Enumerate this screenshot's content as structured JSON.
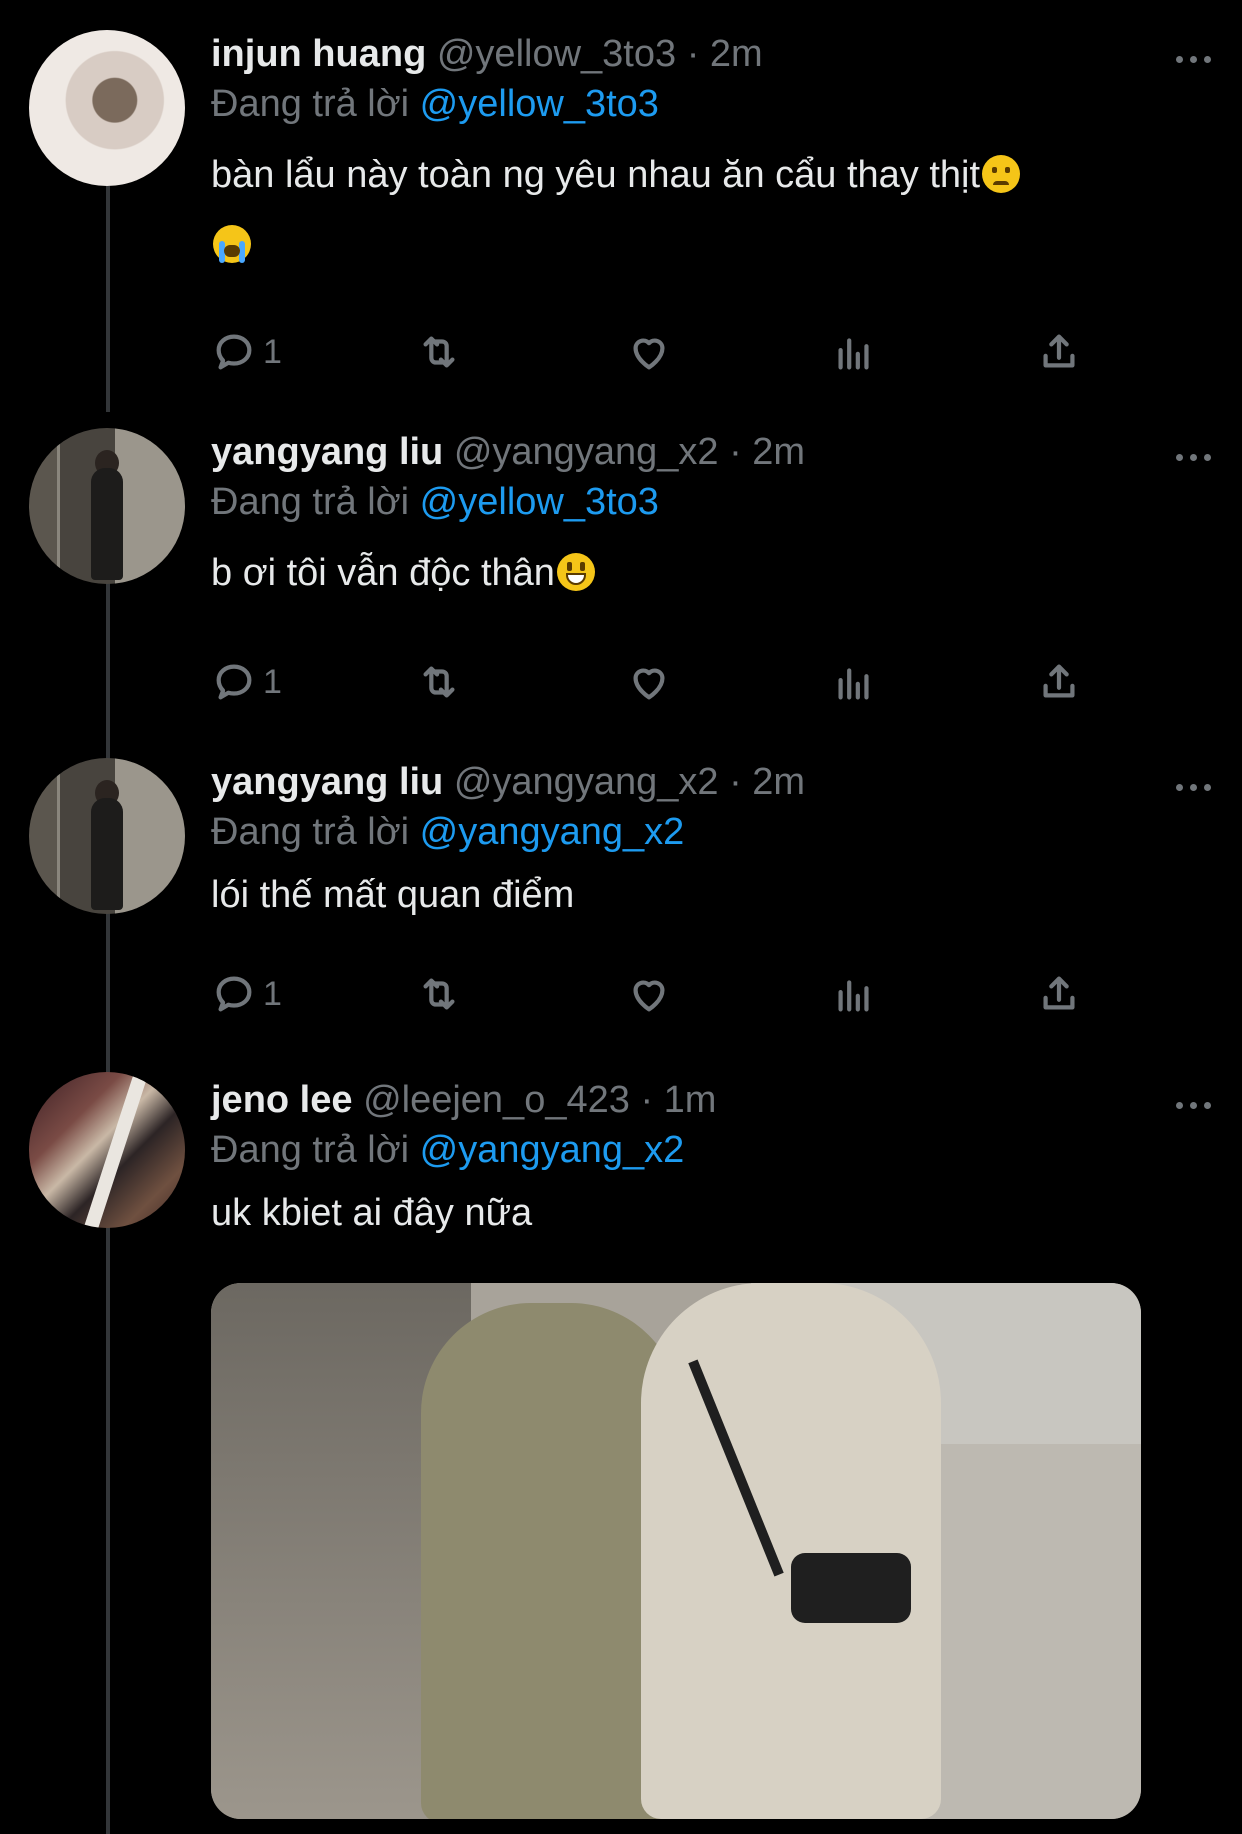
{
  "tweets": [
    {
      "name": "injun huang",
      "handle": "@yellow_3to3",
      "time": "2m",
      "reply_prefix": "Đang trả lời",
      "reply_to": "@yellow_3to3",
      "text": "bàn lẩu này toàn ng yêu nhau ăn cẩu thay thịt",
      "emojis": [
        "disappointed-face",
        "loudly-crying-face"
      ],
      "reply_count": "1"
    },
    {
      "name": "yangyang liu",
      "handle": "@yangyang_x2",
      "time": "2m",
      "reply_prefix": "Đang trả lời",
      "reply_to": "@yellow_3to3",
      "text": "b ơi tôi vẫn độc thân",
      "emojis": [
        "grinning-face"
      ],
      "reply_count": "1"
    },
    {
      "name": "yangyang liu",
      "handle": "@yangyang_x2",
      "time": "2m",
      "reply_prefix": "Đang trả lời",
      "reply_to": "@yangyang_x2",
      "text": "lói thế mất quan điểm",
      "reply_count": "1"
    },
    {
      "name": "jeno lee",
      "handle": "@leejen_o_423",
      "time": "1m",
      "reply_prefix": "Đang trả lời",
      "reply_to": "@yangyang_x2",
      "text": "uk kbiet ai đây nữa",
      "media": "photo-two-people-in-hoodies-walking"
    }
  ],
  "separator": "·",
  "icons": {
    "reply": "reply-icon",
    "retweet": "retweet-icon",
    "like": "heart-icon",
    "views": "views-icon",
    "share": "share-icon",
    "more": "more-icon"
  },
  "colors": {
    "background": "#000000",
    "text": "#e7e9ea",
    "secondary": "#71767b",
    "accent": "#1d9bf0",
    "thread_line": "#333639"
  }
}
